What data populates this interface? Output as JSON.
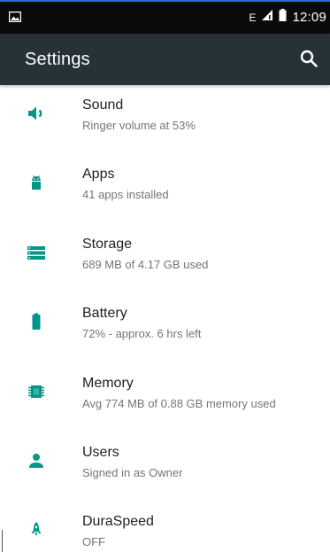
{
  "status_bar": {
    "time": "12:09",
    "network": "E",
    "icons": [
      "image-icon",
      "signal-icon",
      "battery-icon"
    ]
  },
  "header": {
    "title": "Settings",
    "search_icon": "search-icon"
  },
  "settings": [
    {
      "id": "sound",
      "title": "Sound",
      "summary": "Ringer volume at 53%",
      "icon": "volume-icon"
    },
    {
      "id": "apps",
      "title": "Apps",
      "summary": "41 apps installed",
      "icon": "android-icon"
    },
    {
      "id": "storage",
      "title": "Storage",
      "summary": "689 MB of 4.17 GB used",
      "icon": "storage-icon"
    },
    {
      "id": "battery",
      "title": "Battery",
      "summary": "72% - approx. 6 hrs left",
      "icon": "battery-icon"
    },
    {
      "id": "memory",
      "title": "Memory",
      "summary": "Avg 774 MB of 0.88 GB memory used",
      "icon": "memory-icon"
    },
    {
      "id": "users",
      "title": "Users",
      "summary": "Signed in as Owner",
      "icon": "person-icon"
    },
    {
      "id": "duraspeed",
      "title": "DuraSpeed",
      "summary": "OFF",
      "icon": "rocket-icon"
    }
  ],
  "colors": {
    "accent": "#009688",
    "app_bar": "#263238",
    "status_bar": "#0b0b0b"
  }
}
